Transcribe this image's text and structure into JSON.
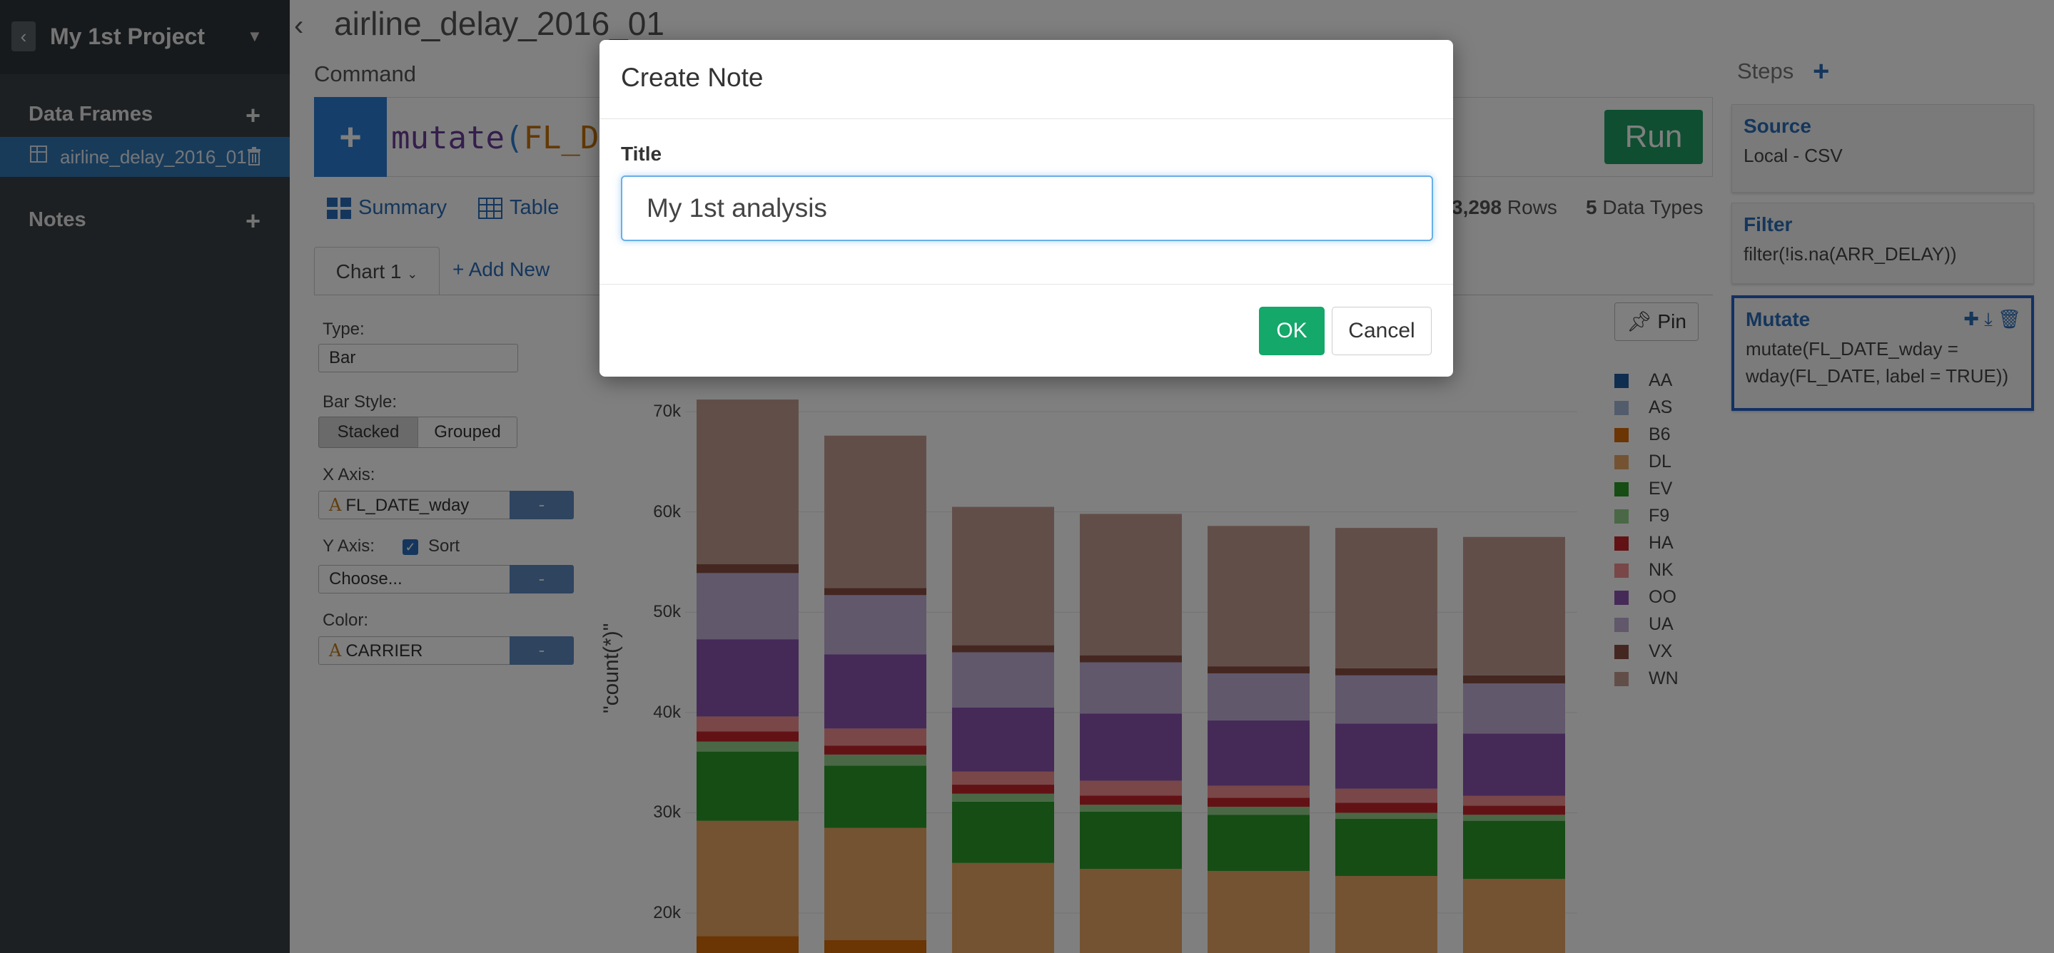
{
  "sidebar": {
    "project_title": "My 1st Project",
    "back_icon": "chevron-left-icon",
    "caret_icon": "chevron-down-icon",
    "data_frames_label": "Data Frames",
    "data_frames": [
      {
        "label": "airline_delay_2016_01"
      }
    ],
    "notes_label": "Notes"
  },
  "main": {
    "df_title": "airline_delay_2016_01",
    "command_label": "Command",
    "command_fn": "mutate",
    "command_paren": "(",
    "command_arg": "FL_DA",
    "run_label": "Run",
    "tabs": [
      {
        "label": "Summary"
      },
      {
        "label": "Table"
      }
    ],
    "rows_count": "3,298",
    "rows_label": "Rows",
    "types_count": "5",
    "types_label": "Data Types",
    "chart_tab_label": "Chart 1",
    "add_new_label": "+ Add New",
    "pin_label": "Pin"
  },
  "config": {
    "type_label": "Type:",
    "type_value": "Bar",
    "bar_style_label": "Bar Style:",
    "bar_style_options": [
      "Stacked",
      "Grouped"
    ],
    "bar_style_selected": "Stacked",
    "x_axis_label": "X Axis:",
    "x_axis_value": "FL_DATE_wday",
    "y_axis_label": "Y Axis:",
    "y_axis_value": "Choose...",
    "sort_label": "Sort",
    "sort_checked": true,
    "color_label": "Color:",
    "color_value": "CARRIER",
    "type_glyph": "A",
    "minus": "-"
  },
  "chart_data": {
    "type": "bar",
    "stacked": true,
    "ylabel": "\"count(*)\"",
    "yticks": [
      "70k",
      "60k",
      "50k",
      "40k",
      "30k",
      "20k"
    ],
    "ytick_values": [
      70000,
      60000,
      50000,
      40000,
      30000,
      20000
    ],
    "legend": [
      "AA",
      "AS",
      "B6",
      "DL",
      "EV",
      "F9",
      "HA",
      "NK",
      "OO",
      "UA",
      "VX",
      "WN"
    ],
    "colors": [
      "#1f5a9e",
      "#a7b8d9",
      "#d66a08",
      "#e8a765",
      "#2a9a2a",
      "#94d18a",
      "#c4242a",
      "#f28f91",
      "#8a55b0",
      "#c3b1d9",
      "#8b4f45",
      "#c49c92"
    ],
    "ylim_visible": [
      16000,
      73000
    ],
    "series_bottom": 16000,
    "bars": [
      {
        "B6": 17700,
        "DL": 29200,
        "EV": 36100,
        "F9": 37100,
        "HA": 38100,
        "NK": 39600,
        "OO": 47300,
        "UA": 53900,
        "VX": 54800,
        "WN": 71200
      },
      {
        "B6": 17300,
        "DL": 28500,
        "EV": 34700,
        "F9": 35800,
        "HA": 36700,
        "NK": 38400,
        "OO": 45800,
        "UA": 51700,
        "VX": 52400,
        "WN": 67600
      },
      {
        "B6": 16000,
        "DL": 25000,
        "EV": 31100,
        "F9": 31900,
        "HA": 32800,
        "NK": 34100,
        "OO": 40500,
        "UA": 46000,
        "VX": 46700,
        "WN": 60500
      },
      {
        "B6": 16000,
        "DL": 24400,
        "EV": 30100,
        "F9": 30800,
        "HA": 31700,
        "NK": 33200,
        "OO": 39900,
        "UA": 45000,
        "VX": 45700,
        "WN": 59800
      },
      {
        "B6": 16000,
        "DL": 24200,
        "EV": 29800,
        "F9": 30600,
        "HA": 31500,
        "NK": 32700,
        "OO": 39200,
        "UA": 43900,
        "VX": 44600,
        "WN": 58600
      },
      {
        "B6": 16000,
        "DL": 23700,
        "EV": 29400,
        "F9": 30000,
        "HA": 31000,
        "NK": 32400,
        "OO": 38900,
        "UA": 43700,
        "VX": 44400,
        "WN": 58400
      },
      {
        "B6": 16000,
        "DL": 23400,
        "EV": 29200,
        "F9": 29800,
        "HA": 30700,
        "NK": 31700,
        "OO": 37900,
        "UA": 42900,
        "VX": 43700,
        "WN": 57500
      }
    ]
  },
  "steps": {
    "label": "Steps",
    "items": [
      {
        "title": "Source",
        "body": "Local - CSV"
      },
      {
        "title": "Filter",
        "body": "filter(!is.na(ARR_DELAY))"
      },
      {
        "title": "Mutate",
        "body": "mutate(FL_DATE_wday = wday(FL_DATE, label = TRUE))"
      }
    ]
  },
  "modal": {
    "title": "Create Note",
    "field_label": "Title",
    "field_value": "My 1st analysis",
    "ok_label": "OK",
    "cancel_label": "Cancel"
  }
}
